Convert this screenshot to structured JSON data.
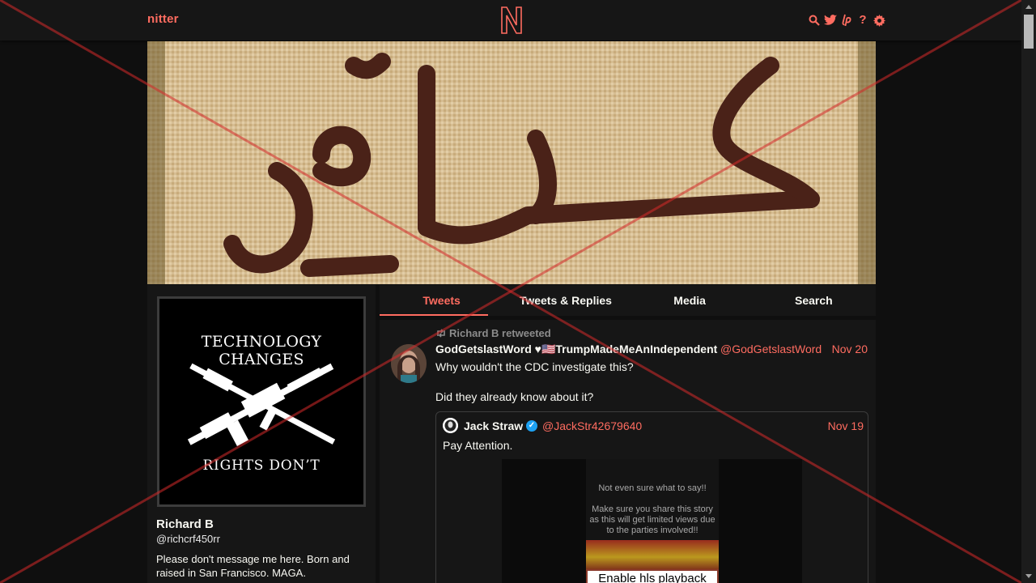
{
  "nav": {
    "brand": "nitter",
    "logo_letter": "N",
    "icons": [
      "search-icon",
      "twitter-icon",
      "liberapay-icon",
      "help-icon",
      "settings-icon"
    ]
  },
  "profile": {
    "avatar_top_text": "TECHNOLOGY CHANGES",
    "avatar_bottom_text": "RIGHTS DON’T",
    "fullname": "Richard B",
    "username": "@richcrf450rr",
    "bio": "Please don't message me here.  Born and raised in San Francisco. MAGA."
  },
  "tabs": [
    {
      "label": "Tweets",
      "active": true
    },
    {
      "label": "Tweets & Replies",
      "active": false
    },
    {
      "label": "Media",
      "active": false
    },
    {
      "label": "Search",
      "active": false
    }
  ],
  "tweet": {
    "retweet_header": "Richard B retweeted",
    "fullname": "GodGetslastWord ♥🇺🇸TrumpMadeMeAnIndependent",
    "handle": "@GodGetslastWord",
    "date": "Nov 20",
    "body": [
      "Why wouldn't the CDC investigate this?",
      "Did they already know about it?"
    ],
    "quote": {
      "fullname": "Jack Straw",
      "handle": "@JackStr42679640",
      "date": "Nov 19",
      "text": "Pay Attention.",
      "media_text": [
        "Not even sure what to say!!",
        "Make sure you share this story as this will get limited views due to the parties involved!!"
      ],
      "media_button": "Enable hls playback"
    }
  },
  "colors": {
    "accent": "#ff6c60",
    "background": "#0f0f0f",
    "panel": "#161616",
    "text": "#f8f8f2",
    "overlay_cross": "#d42a2a"
  }
}
